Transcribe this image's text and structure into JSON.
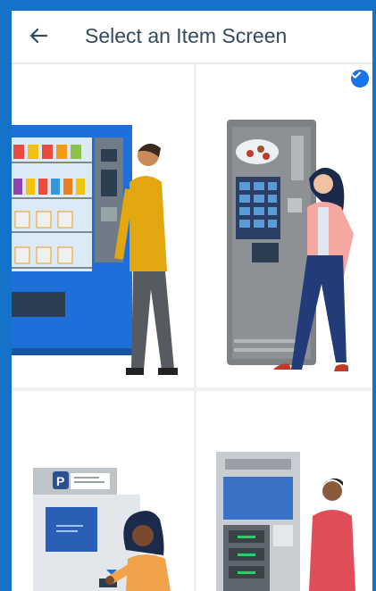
{
  "header": {
    "title": "Select an Item Screen",
    "back_icon": "arrow-left-icon"
  },
  "items": [
    {
      "name": "snack-vending-machine",
      "selected": false
    },
    {
      "name": "coffee-vending-machine",
      "selected": true
    },
    {
      "name": "parking-pay-station",
      "selected": false
    },
    {
      "name": "locker-kiosk",
      "selected": false
    }
  ],
  "colors": {
    "accent": "#1572c9",
    "check": "#1a73e8",
    "title": "#34495e"
  }
}
